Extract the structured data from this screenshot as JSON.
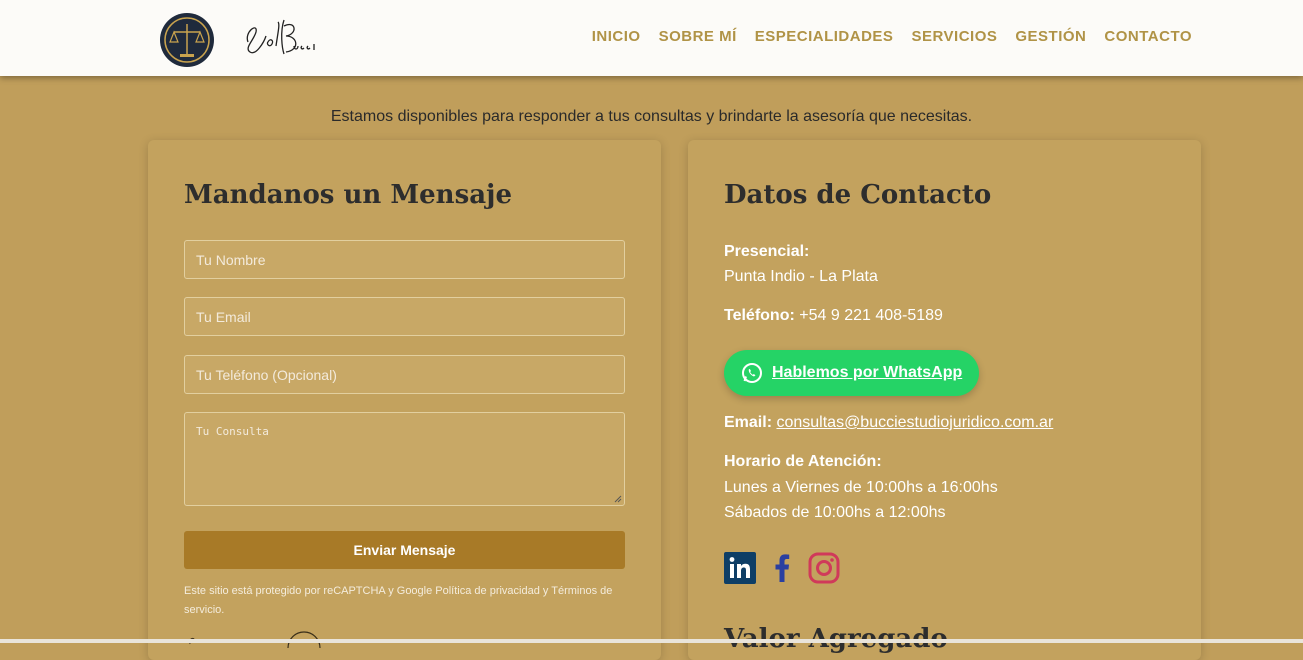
{
  "header": {
    "seal_text": "ESTUDIO JURÍDICO INTEGRAL",
    "signature_text": "Sol Bucci",
    "nav": [
      "INICIO",
      "SOBRE MÍ",
      "ESPECIALIDADES",
      "SERVICIOS",
      "GESTIÓN",
      "CONTACTO"
    ]
  },
  "intro": "Estamos disponibles para responder a tus consultas y brindarte la asesoría que necesitas.",
  "form": {
    "title": "Mandanos un Mensaje",
    "name_placeholder": "Tu Nombre",
    "email_placeholder": "Tu Email",
    "phone_placeholder": "Tu Teléfono (Opcional)",
    "message_placeholder": "Tu Consulta",
    "submit_label": "Enviar Mensaje",
    "recaptcha_note": "Este sitio está protegido por reCAPTCHA y Google Política de privacidad y Términos de servicio."
  },
  "contact": {
    "title": "Datos de Contacto",
    "presencial_label": "Presencial:",
    "presencial_value": "Punta Indio - La Plata",
    "phone_label": "Teléfono:",
    "phone_value": "+54 9 221 408-5189",
    "whatsapp_label": "Hablemos por WhatsApp",
    "email_label": "Email:",
    "email_value": "consultas@bucciestudiojuridico.com.ar",
    "hours_label": "Horario de Atención:",
    "hours_weekdays": "Lunes a Viernes de 10:00hs a 16:00hs",
    "hours_saturday": "Sábados de 10:00hs a 12:00hs",
    "social_icons": [
      "linkedin-icon",
      "facebook-icon",
      "instagram-icon"
    ],
    "next_section_title": "Valor Agregado"
  },
  "colors": {
    "background": "#c09e5b",
    "nav_text": "#b09346",
    "submit_bg": "#a87a27",
    "whatsapp_bg": "#25d366",
    "linkedin": "#0e3e66",
    "facebook": "#2a3fa0",
    "instagram": "#d03a5a"
  }
}
